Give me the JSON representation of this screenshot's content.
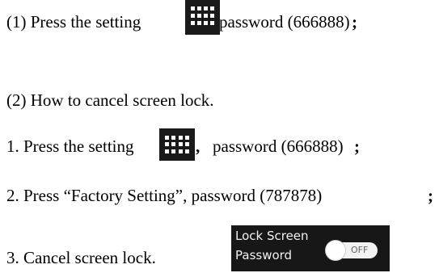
{
  "steps": {
    "step1": {
      "prefix": "(1) Press the setting",
      "comma": ",",
      "suffix": "password (666888)",
      "end": ";"
    },
    "step2": {
      "text": "(2) How to cancel screen lock."
    },
    "step3": {
      "prefix": "1. Press the setting",
      "comma": ",",
      "suffix": "password (666888)",
      "end": ";"
    },
    "step4": {
      "text": "2. Press “Factory Setting”, password (787878)",
      "end": ";"
    },
    "step5": {
      "text": "3. Cancel screen lock."
    }
  },
  "icons": {
    "settings_grid": "grid-icon"
  },
  "lock_panel": {
    "label_line1": "Lock Screen",
    "label_line2": "Password",
    "toggle_text": "OFF",
    "toggle_state": "off"
  }
}
